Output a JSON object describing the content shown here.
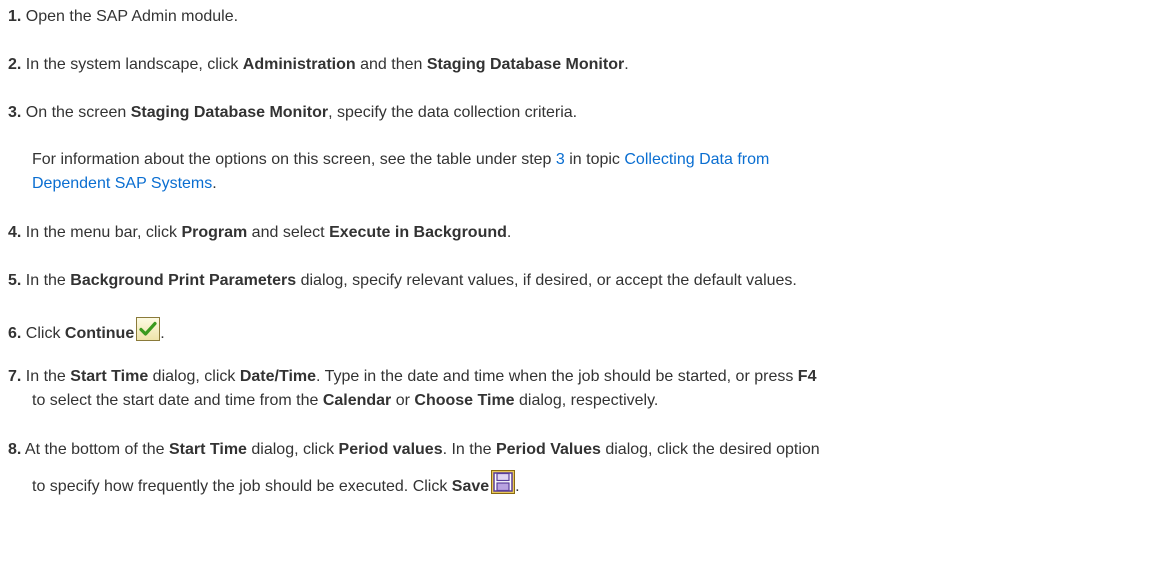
{
  "steps": [
    {
      "num": "1.",
      "pre": "Open the SAP Admin module."
    },
    {
      "num": "2.",
      "pre": "In the system landscape, click ",
      "b1": "Administration",
      "mid": " and then ",
      "b2": "Staging Database Monitor",
      "post": "."
    },
    {
      "num": "3.",
      "pre": "On the screen ",
      "b1": "Staging Database Monitor",
      "post": ", specify the data collection criteria."
    },
    {
      "num": "4.",
      "pre": "In the menu bar, click ",
      "b1": "Program",
      "mid": " and select ",
      "b2": "Execute in Background",
      "post": "."
    },
    {
      "num": "5.",
      "pre": "In the ",
      "b1": "Background Print Parameters",
      "post": " dialog, specify relevant values, if desired, or accept the default values."
    },
    {
      "num": "6.",
      "pre": "Click ",
      "b1": "Continue",
      "post": "."
    },
    {
      "num": "7.",
      "pre": "In the ",
      "b1": "Start Time",
      "mid": " dialog, click ",
      "b2": "Date/Time",
      "mid2": ". Type in the date and time when the job should be started, or press ",
      "b3": "F4",
      "line2_pre": "to select the start date and time from the ",
      "line2_b1": "Calendar",
      "line2_mid": " or ",
      "line2_b2": "Choose Time",
      "line2_post": " dialog, respectively."
    },
    {
      "num": "8.",
      "pre": "At the bottom of the ",
      "b1": "Start Time",
      "mid": " dialog, click ",
      "b2": "Period values",
      "mid2": ". In the ",
      "b3": "Period Values",
      "post": " dialog, click the desired option",
      "line2_pre": "to specify how frequently the job should be executed. Click ",
      "line2_b1": "Save",
      "line2_post": "."
    }
  ],
  "note": {
    "pre": "For information about the options on this screen, see the table under step ",
    "step_link": "3",
    "mid": " in topic ",
    "topic_link_line1": "Collecting Data from",
    "topic_link_line2": "Dependent SAP Systems",
    "post": "."
  },
  "icons": {
    "continue": "checkmark-icon",
    "save": "save-disk-icon"
  },
  "colors": {
    "link": "#0a6ed1",
    "text": "#333333",
    "check": "#3a9a1e",
    "save_fill": "#e8c85a"
  }
}
